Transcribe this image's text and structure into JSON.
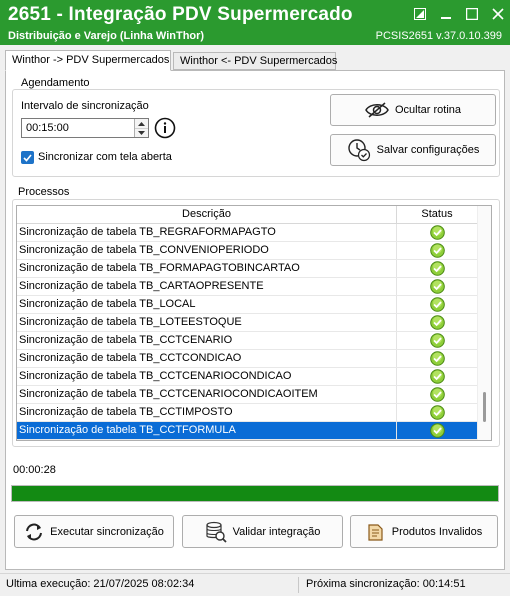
{
  "window": {
    "title": "2651 - Integração PDV Supermercado",
    "subtitle": "Distribuição e Varejo (Linha WinThor)",
    "version": "PCSIS2651  v.37.0.10.399",
    "bg_color": "#2b9a2f"
  },
  "tabs": [
    {
      "label": "Winthor -> PDV Supermercados",
      "active": true
    },
    {
      "label": "Winthor <- PDV Supermercados",
      "active": false
    }
  ],
  "agendamento": {
    "title": "Agendamento",
    "interval_label": "Intervalo de sincronização",
    "interval_value": "00:15:00",
    "sync_open_label": "Sincronizar com tela aberta",
    "sync_open_checked": true,
    "hide_button": "Ocultar rotina",
    "save_button": "Salvar configurações"
  },
  "processos": {
    "title": "Processos",
    "columns": {
      "desc": "Descrição",
      "status": "Status"
    },
    "rows": [
      {
        "desc": "Sincronização de tabela TB_REGRAFORMAPAGTO",
        "status": "ok"
      },
      {
        "desc": "Sincronização de tabela TB_CONVENIOPERIODO",
        "status": "ok"
      },
      {
        "desc": "Sincronização de tabela TB_FORMAPAGTOBINCARTAO",
        "status": "ok"
      },
      {
        "desc": "Sincronização de tabela TB_CARTAOPRESENTE",
        "status": "ok"
      },
      {
        "desc": "Sincronização de tabela TB_LOCAL",
        "status": "ok"
      },
      {
        "desc": "Sincronização de tabela TB_LOTEESTOQUE",
        "status": "ok"
      },
      {
        "desc": "Sincronização de tabela TB_CCTCENARIO",
        "status": "ok"
      },
      {
        "desc": "Sincronização de tabela TB_CCTCONDICAO",
        "status": "ok"
      },
      {
        "desc": "Sincronização de tabela TB_CCTCENARIOCONDICAO",
        "status": "ok"
      },
      {
        "desc": "Sincronização de tabela TB_CCTCENARIOCONDICAOITEM",
        "status": "ok"
      },
      {
        "desc": "Sincronização de tabela TB_CCTIMPOSTO",
        "status": "ok"
      },
      {
        "desc": "Sincronização de tabela TB_CCTFORMULA",
        "status": "ok",
        "selected": true
      }
    ]
  },
  "elapsed": "00:00:28",
  "progress_fraction": 1.0,
  "actions": {
    "execute": "Executar sincronização",
    "validate": "Validar integração",
    "invalid_products": "Produtos Invalidos"
  },
  "statusbar": {
    "last_run": "Ultima execução: 21/07/2025 08:02:34",
    "next_sync": "Próxima sincronização: 00:14:51"
  }
}
